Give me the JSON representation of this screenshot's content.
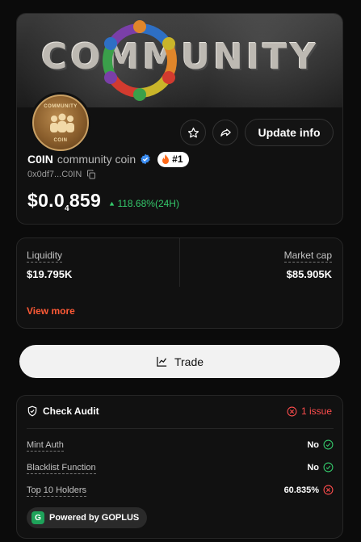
{
  "token": {
    "banner_text": "COMMUNITY",
    "avatar_text_top": "COMMUNITY",
    "avatar_text_bottom": "COIN",
    "ticker": "C0IN",
    "name": "community coin",
    "verified": true,
    "rank": "#1",
    "address": "0x0df7...C0IN",
    "price_prefix": "$0.0",
    "price_zeros_subscript": "4",
    "price_digits": "859",
    "change": "118.68%(24H)",
    "change_color": "#34c96b"
  },
  "actions": {
    "update_label": "Update info"
  },
  "stats": {
    "liquidity_label": "Liquidity",
    "liquidity_value": "$19.795K",
    "marketcap_label": "Market cap",
    "marketcap_value": "$85.905K",
    "view_more": "View more",
    "accent": "#ff5a36"
  },
  "trade": {
    "label": "Trade"
  },
  "audit": {
    "title": "Check Audit",
    "issues": "1 issue",
    "rows": [
      {
        "label": "Mint Auth",
        "value": "No",
        "status": "pass"
      },
      {
        "label": "Blacklist Function",
        "value": "No",
        "status": "pass"
      },
      {
        "label": "Top 10 Holders",
        "value": "60.835%",
        "status": "fail"
      }
    ],
    "powered_by": "Powered by GOPLUS",
    "pass_color": "#34c96b",
    "fail_color": "#ff4d4d"
  }
}
